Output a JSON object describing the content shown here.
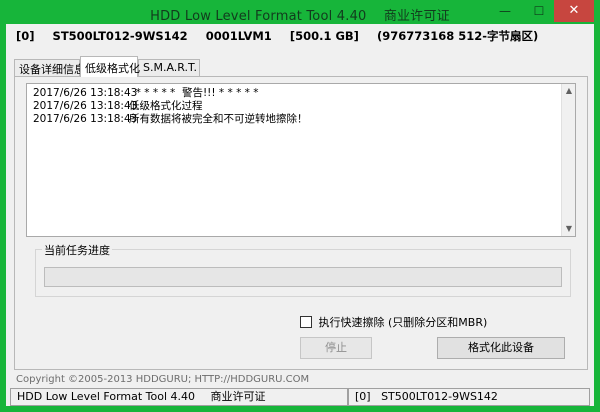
{
  "window": {
    "title": "HDD Low Level Format Tool 4.40",
    "title_suffix": "商业许可证",
    "min_glyph": "—",
    "max_glyph": "☐",
    "close_glyph": "✕"
  },
  "drive": {
    "index": "[0]",
    "model": "ST500LT012-9WS142",
    "firmware": "0001LVM1",
    "capacity": "[500.1 GB]",
    "sectors": "(976773168 512-字节扇区)"
  },
  "tabs": [
    {
      "label": "设备详细信息"
    },
    {
      "label": "低级格式化"
    },
    {
      "label": "S.M.A.R.T."
    }
  ],
  "log": [
    {
      "time": "2017/6/26 13:18:43",
      "message": "  * * * * *  警告!!! * * * * *"
    },
    {
      "time": "2017/6/26 13:18:43",
      "message": "低级格式化过程"
    },
    {
      "time": "2017/6/26 13:18:43",
      "message": "所有数据将被完全和不可逆转地擦除！"
    }
  ],
  "progress": {
    "label": "当前任务进度",
    "value": 0
  },
  "options": {
    "quick_erase_label": "执行快速擦除 (只删除分区和MBR)",
    "quick_erase_checked": false
  },
  "buttons": {
    "stop": "停止",
    "format": "格式化此设备"
  },
  "footer": {
    "copyright": "Copyright ©2005-2013 HDDGURU;   HTTP://HDDGURU.COM"
  },
  "status": {
    "app": "HDD Low Level Format Tool 4.40",
    "license": "商业许可证",
    "drive": "[0]   ST500LT012-9WS142"
  },
  "colors": {
    "frame": "#17b53a",
    "progress_fill": "#06b025"
  }
}
